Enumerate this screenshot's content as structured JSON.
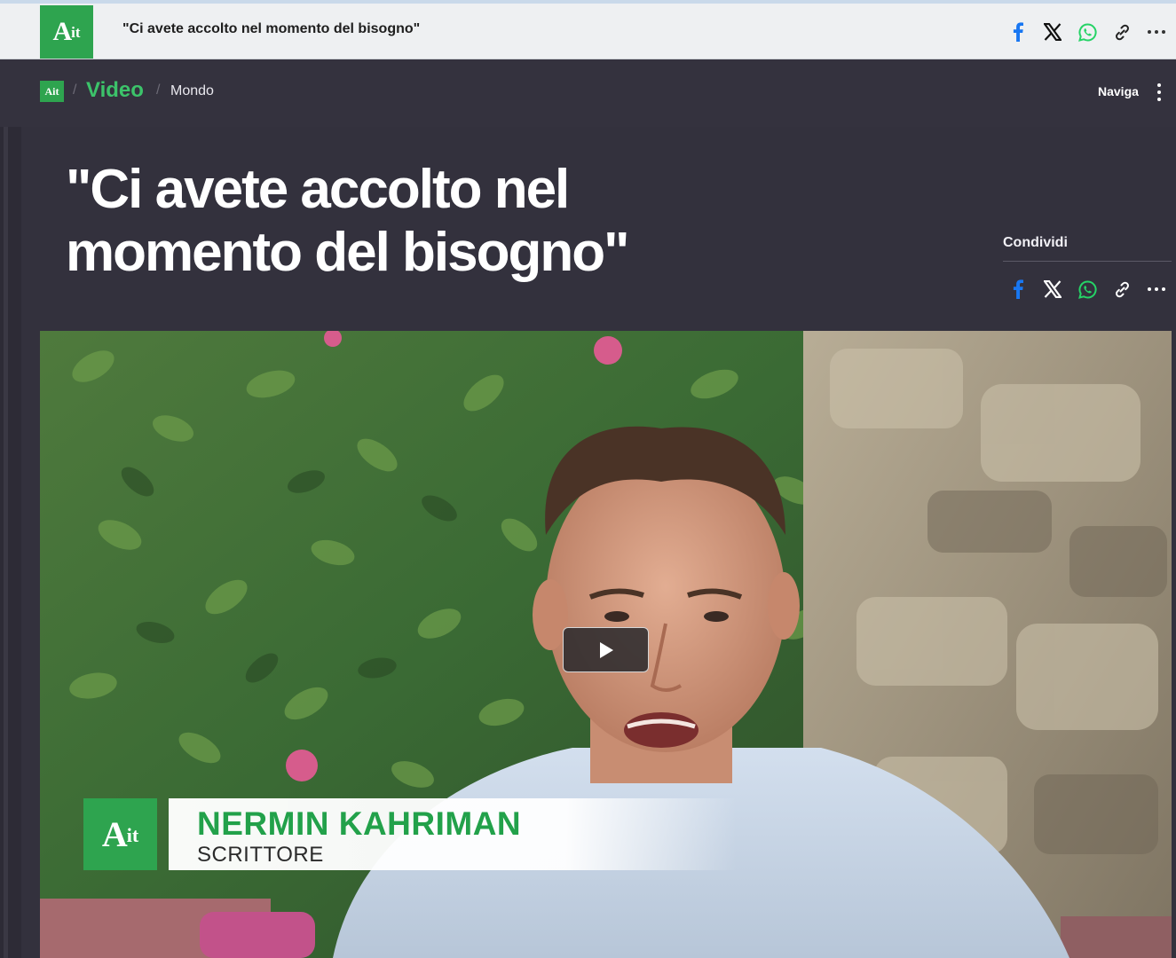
{
  "topbar": {
    "logo": {
      "main": "A",
      "suffix": "it"
    },
    "title": "\"Ci avete accolto nel momento del bisogno\"",
    "share_icons": [
      "facebook-icon",
      "x-icon",
      "whatsapp-icon",
      "link-icon",
      "more-icon"
    ]
  },
  "breadcrumb": {
    "logo": "Ait",
    "separator": "/",
    "section": "Video",
    "subsection": "Mondo",
    "menu_label": "Naviga",
    "menu_icon": "kebab-menu-icon"
  },
  "article": {
    "headline_line1": "\"Ci avete accolto nel",
    "headline_line2": "momento del bisogno\"",
    "share_label": "Condividi",
    "share_icons": [
      "facebook-icon",
      "x-icon",
      "whatsapp-icon",
      "link-icon",
      "more-icon"
    ]
  },
  "video": {
    "play_icon": "play-icon",
    "lower_third": {
      "logo": {
        "main": "A",
        "suffix": "it"
      },
      "name": "NERMIN KAHRIMAN",
      "role": "SCRITTORE"
    }
  },
  "colors": {
    "brand_green": "#2ea44f",
    "section_green": "#3cc36a",
    "facebook_blue": "#1877f2",
    "whatsapp_green": "#25d366",
    "page_dark": "#33313d"
  }
}
